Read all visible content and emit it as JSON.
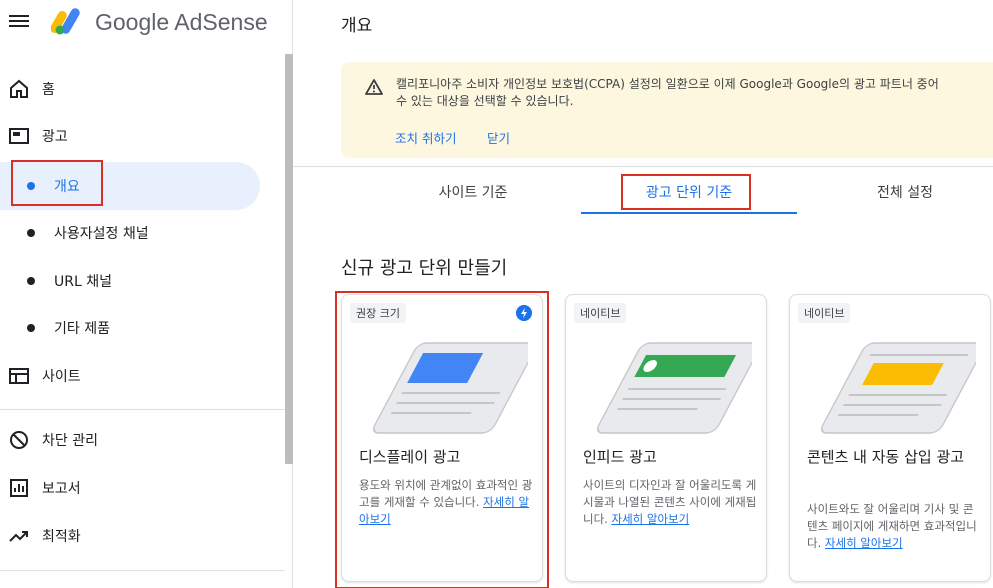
{
  "header": {
    "brand": "Google AdSense",
    "page_title": "개요"
  },
  "sidebar": {
    "items": [
      {
        "label": "홈",
        "icon": "home-icon"
      },
      {
        "label": "광고",
        "icon": "ads-icon"
      },
      {
        "label": "개요",
        "active": true
      },
      {
        "label": "사용자설정 채널"
      },
      {
        "label": "URL 채널"
      },
      {
        "label": "기타 제품"
      },
      {
        "label": "사이트",
        "icon": "sites-icon"
      },
      {
        "label": "차단 관리",
        "icon": "block-icon"
      },
      {
        "label": "보고서",
        "icon": "reports-icon"
      },
      {
        "label": "최적화",
        "icon": "optimization-icon"
      }
    ]
  },
  "banner": {
    "text": "캘리포니아주 소비자 개인정보 보호법(CCPA) 설정의 일환으로 이제 Google과 Google의 광고 파트너 중어\n수 있는 대상을 선택할 수 있습니다.",
    "action": "조치 취하기",
    "dismiss": "닫기"
  },
  "tabs": [
    {
      "label": "사이트 기준"
    },
    {
      "label": "광고 단위 기준",
      "active": true
    },
    {
      "label": "전체 설정"
    }
  ],
  "section_title": "신규 광고 단위 만들기",
  "cards": [
    {
      "chip": "권장 크기",
      "title": "디스플레이 광고",
      "desc": "용도와 위치에 관계없이 효과적인 광고를 게재할 수 있습니다.",
      "link": "자세히 알아보기",
      "accent": "#4285f4"
    },
    {
      "chip": "네이티브",
      "title": "인피드 광고",
      "desc": "사이트의 디자인과 잘 어울리도록 게시물과 나열된 콘텐츠 사이에 게재됩니다.",
      "link": "자세히 알아보기",
      "accent": "#34a853"
    },
    {
      "chip": "네이티브",
      "title": "콘텐츠 내 자동 삽입 광고",
      "desc": "사이트와도 잘 어울리며 기사 및 콘텐츠 페이지에 게재하면 효과적입니다.",
      "link": "자세히 알아보기",
      "accent": "#fbbc04"
    }
  ],
  "colors": {
    "accent": "#1a73e8",
    "highlight_box": "#d93025",
    "banner_bg": "#fef7e0"
  }
}
